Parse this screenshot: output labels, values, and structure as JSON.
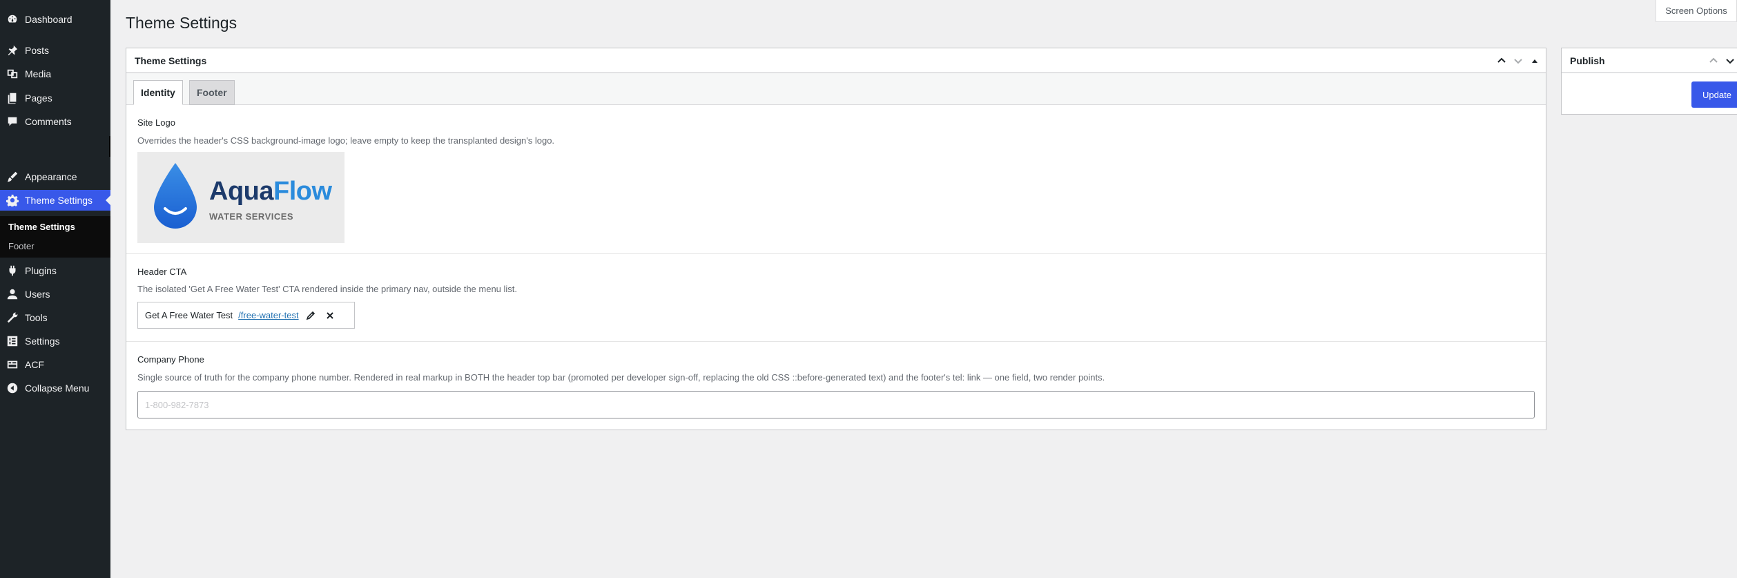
{
  "sidebar": {
    "items": [
      {
        "label": "Dashboard",
        "icon": "dashboard-icon"
      },
      {
        "label": "Posts",
        "icon": "pin-icon"
      },
      {
        "label": "Media",
        "icon": "media-icon"
      },
      {
        "label": "Pages",
        "icon": "pages-icon"
      },
      {
        "label": "Comments",
        "icon": "comment-icon"
      },
      {
        "label": "Appearance",
        "icon": "brush-icon"
      },
      {
        "label": "Theme Settings",
        "icon": "gear-icon"
      },
      {
        "label": "Plugins",
        "icon": "plug-icon"
      },
      {
        "label": "Users",
        "icon": "user-icon"
      },
      {
        "label": "Tools",
        "icon": "wrench-icon"
      },
      {
        "label": "Settings",
        "icon": "sliders-icon"
      },
      {
        "label": "ACF",
        "icon": "acf-icon"
      },
      {
        "label": "Collapse Menu",
        "icon": "collapse-icon"
      }
    ],
    "submenu": [
      {
        "label": "Theme Settings"
      },
      {
        "label": "Footer"
      }
    ]
  },
  "page": {
    "title": "Theme Settings",
    "screen_options": "Screen Options"
  },
  "settings_box": {
    "title": "Theme Settings",
    "tabs": [
      {
        "label": "Identity",
        "active": true
      },
      {
        "label": "Footer",
        "active": false
      }
    ],
    "site_logo": {
      "label": "Site Logo",
      "description": "Overrides the header's CSS background-image logo; leave empty to keep the transplanted design's logo.",
      "logo_word_1": "Aqua",
      "logo_word_2": "Flow",
      "logo_tagline": "WATER SERVICES"
    },
    "header_cta": {
      "label": "Header CTA",
      "description": "The isolated 'Get A Free Water Test' CTA rendered inside the primary nav, outside the menu list.",
      "link_title": "Get A Free Water Test",
      "link_url": "/free-water-test"
    },
    "company_phone": {
      "label": "Company Phone",
      "description": "Single source of truth for the company phone number. Rendered in real markup in BOTH the header top bar (promoted per developer sign-off, replacing the old CSS ::before-generated text) and the footer's tel: link — one field, two render points.",
      "value": "1-800-982-7873"
    }
  },
  "publish_box": {
    "title": "Publish",
    "update_label": "Update"
  },
  "colors": {
    "accent": "#3858e9",
    "sidebar_bg": "#1d2327",
    "logo_dark": "#1c3a6b",
    "logo_light": "#2a8bdc"
  }
}
